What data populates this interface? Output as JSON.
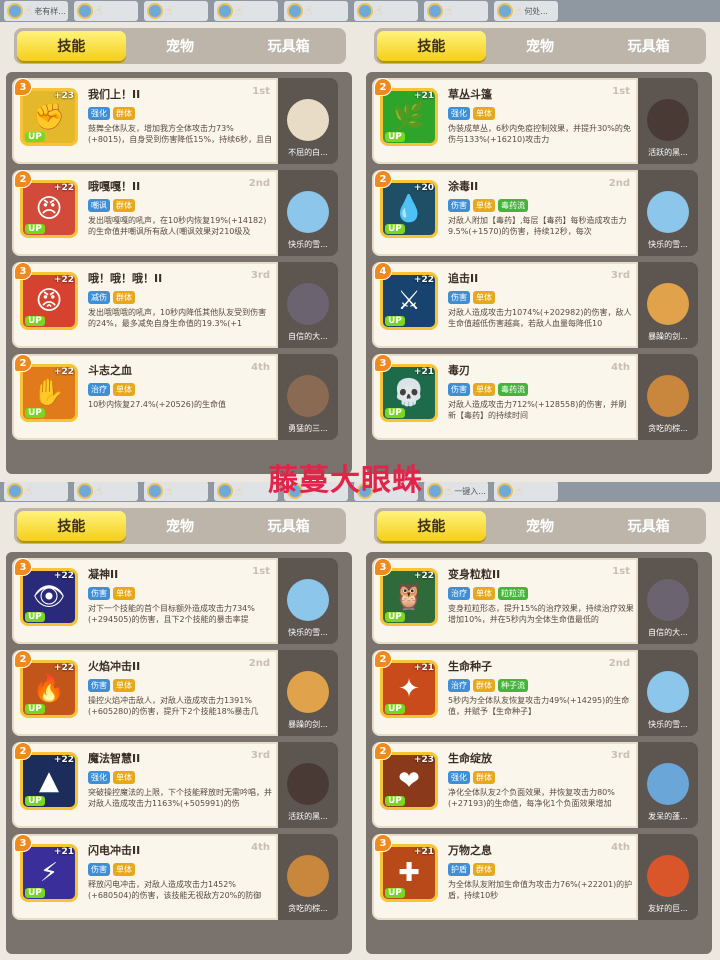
{
  "watermark": "藤蔓大眼蛛",
  "tabs": [
    "技能",
    "宠物",
    "玩具箱"
  ],
  "strip_top_texts": [
    "老有样...",
    "",
    "",
    "",
    "",
    "",
    "",
    "何处..."
  ],
  "strip_mid_texts": [
    "",
    "",
    "",
    "",
    "",
    "",
    "一键入...",
    ""
  ],
  "panels": [
    {
      "cards": [
        {
          "name": "我们上！II",
          "rank": "1st",
          "lvl": "3",
          "plus": "+23",
          "tags": [
            {
              "t": "强化",
              "c": "blue"
            },
            {
              "t": "群体",
              "c": "yellow"
            }
          ],
          "desc": "鼓舞全体队友，增加我方全体攻击力73%(+8015)，自身受到伤害降低15%，持续6秒，且自",
          "pet": "不屈的白...",
          "glyph": "✊",
          "bg": "#e3b82a",
          "petcolor": "#e8dcc6"
        },
        {
          "name": "哦嘎嘎！II",
          "rank": "2nd",
          "lvl": "2",
          "plus": "+22",
          "tags": [
            {
              "t": "嘲讽",
              "c": "blue"
            },
            {
              "t": "群体",
              "c": "yellow"
            }
          ],
          "desc": "发出哦嘎嘎的吼声，在10秒内恢复19%(+14182)的生命值并嘲讽所有敌人(嘲讽效果对210级及",
          "pet": "快乐的雪...",
          "glyph": "😠",
          "bg": "#d24a3a",
          "petcolor": "#8cc6ea"
        },
        {
          "name": "哦！哦！哦！II",
          "rank": "3rd",
          "lvl": "3",
          "plus": "+22",
          "tags": [
            {
              "t": "减伤",
              "c": "blue"
            },
            {
              "t": "群体",
              "c": "yellow"
            }
          ],
          "desc": "发出哦哦哦的吼声，10秒内降低其他队友受到伤害的24%，最多减免自身生命值的19.3%(+1",
          "pet": "自信的大...",
          "glyph": "😡",
          "bg": "#d5422f",
          "petcolor": "#6b6470"
        },
        {
          "name": "斗志之血",
          "rank": "4th",
          "lvl": "2",
          "plus": "+22",
          "tags": [
            {
              "t": "治疗",
              "c": "blue"
            },
            {
              "t": "单体",
              "c": "yellow"
            }
          ],
          "desc": "10秒内恢复27.4%(+20526)的生命值",
          "pet": "勇猛的三...",
          "glyph": "✋",
          "bg": "#e07a1a",
          "petcolor": "#8a6a52"
        }
      ]
    },
    {
      "cards": [
        {
          "name": "草丛斗篷",
          "rank": "1st",
          "lvl": "2",
          "plus": "+21",
          "tags": [
            {
              "t": "强化",
              "c": "blue"
            },
            {
              "t": "单体",
              "c": "yellow"
            }
          ],
          "desc": "伪装成草丛，6秒内免疫控制效果，并提升30%的免伤与133%(+16210)攻击力",
          "pet": "活跃的黑...",
          "glyph": "🌿",
          "bg": "#2ea52a",
          "petcolor": "#4a3a36"
        },
        {
          "name": "涂毒II",
          "rank": "2nd",
          "lvl": "2",
          "plus": "+20",
          "tags": [
            {
              "t": "伤害",
              "c": "blue"
            },
            {
              "t": "单体",
              "c": "yellow"
            },
            {
              "t": "毒药流",
              "c": "green"
            }
          ],
          "desc": "对敌人附加【毒药】,每层【毒药】每秒造成攻击力9.5%(+1570)的伤害，持续12秒，每次",
          "pet": "快乐的雪...",
          "glyph": "💧",
          "bg": "#1f4f66",
          "petcolor": "#8cc6ea"
        },
        {
          "name": "追击II",
          "rank": "3rd",
          "lvl": "4",
          "plus": "+22",
          "tags": [
            {
              "t": "伤害",
              "c": "blue"
            },
            {
              "t": "单体",
              "c": "yellow"
            }
          ],
          "desc": "对敌人造成攻击力1074%(+202982)的伤害，敌人生命值越低伤害越高，若敌人血量每降低10",
          "pet": "暴躁的剑...",
          "glyph": "⚔",
          "bg": "#17436e",
          "petcolor": "#e0a24a"
        },
        {
          "name": "毒刃",
          "rank": "4th",
          "lvl": "3",
          "plus": "+21",
          "tags": [
            {
              "t": "伤害",
              "c": "blue"
            },
            {
              "t": "单体",
              "c": "yellow"
            },
            {
              "t": "毒药流",
              "c": "green"
            }
          ],
          "desc": "对敌人造成攻击力712%(+128558)的伤害，并刷新【毒药】的持续时间",
          "pet": "贪吃的棕...",
          "glyph": "💀",
          "bg": "#1d6b4a",
          "petcolor": "#c8873c"
        }
      ]
    },
    {
      "cards": [
        {
          "name": "凝神II",
          "rank": "1st",
          "lvl": "3",
          "plus": "+22",
          "tags": [
            {
              "t": "伤害",
              "c": "blue"
            },
            {
              "t": "单体",
              "c": "yellow"
            }
          ],
          "desc": "对下一个技能的首个目标额外造成攻击力734%(+294505)的伤害，且下2个技能的暴击率提",
          "pet": "快乐的雪...",
          "glyph": "👁",
          "bg": "#2a2a7a",
          "petcolor": "#8cc6ea"
        },
        {
          "name": "火焰冲击II",
          "rank": "2nd",
          "lvl": "2",
          "plus": "+22",
          "tags": [
            {
              "t": "伤害",
              "c": "blue"
            },
            {
              "t": "单体",
              "c": "yellow"
            }
          ],
          "desc": "操控火焰冲击敌人，对敌人造成攻击力1391%(+605280)的伤害，提升下2个技能18%暴击几",
          "pet": "暴躁的剑...",
          "glyph": "🔥",
          "bg": "#c2561a",
          "petcolor": "#e0a24a"
        },
        {
          "name": "魔法智慧II",
          "rank": "3rd",
          "lvl": "2",
          "plus": "+22",
          "tags": [
            {
              "t": "强化",
              "c": "blue"
            },
            {
              "t": "单体",
              "c": "yellow"
            }
          ],
          "desc": "突破操控魔法的上限，下个技能释放时无需吟唱，并对敌人造成攻击力1163%(+505991)的伤",
          "pet": "活跃的黑...",
          "glyph": "▲",
          "bg": "#1c2d5c",
          "petcolor": "#4a3a36"
        },
        {
          "name": "闪电冲击II",
          "rank": "4th",
          "lvl": "3",
          "plus": "+21",
          "tags": [
            {
              "t": "伤害",
              "c": "blue"
            },
            {
              "t": "单体",
              "c": "yellow"
            }
          ],
          "desc": "释放闪电冲击，对敌人造成攻击力1452%(+680504)的伤害，该技能无视敌方20%的防御",
          "pet": "贪吃的棕...",
          "glyph": "⚡",
          "bg": "#3a2f9a",
          "petcolor": "#c8873c"
        }
      ]
    },
    {
      "cards": [
        {
          "name": "变身粒粒II",
          "rank": "1st",
          "lvl": "3",
          "plus": "+22",
          "tags": [
            {
              "t": "治疗",
              "c": "blue"
            },
            {
              "t": "单体",
              "c": "yellow"
            },
            {
              "t": "粒粒流",
              "c": "green"
            }
          ],
          "desc": "变身粒粒形态，提升15%的治疗效果，持续治疗效果增加10%，并在5秒内为全体生命值最低的",
          "pet": "自信的大...",
          "glyph": "🦉",
          "bg": "#2f6a3a",
          "petcolor": "#6b6470"
        },
        {
          "name": "生命种子",
          "rank": "2nd",
          "lvl": "2",
          "plus": "+21",
          "tags": [
            {
              "t": "治疗",
              "c": "blue"
            },
            {
              "t": "群体",
              "c": "yellow"
            },
            {
              "t": "种子流",
              "c": "green"
            }
          ],
          "desc": "5秒内为全体队友恢复攻击力49%(+14295)的生命值，并赋予【生命种子】",
          "pet": "快乐的雪...",
          "glyph": "✦",
          "bg": "#c94a1a",
          "petcolor": "#8cc6ea"
        },
        {
          "name": "生命绽放",
          "rank": "3rd",
          "lvl": "2",
          "plus": "+23",
          "tags": [
            {
              "t": "强化",
              "c": "blue"
            },
            {
              "t": "群体",
              "c": "yellow"
            }
          ],
          "desc": "净化全体队友2个负面效果，并恢复攻击力80%(+27193)的生命值，每净化1个负面效果增加",
          "pet": "发呆的蓬...",
          "glyph": "❤",
          "bg": "#8a3a1a",
          "petcolor": "#6aa6d8"
        },
        {
          "name": "万物之息",
          "rank": "4th",
          "lvl": "3",
          "plus": "+21",
          "tags": [
            {
              "t": "护盾",
              "c": "blue"
            },
            {
              "t": "群体",
              "c": "yellow"
            }
          ],
          "desc": "为全体队友附加生命值为攻击力76%(+22201)的护盾，持续10秒",
          "pet": "友好的巨...",
          "glyph": "✚",
          "bg": "#b84a1a",
          "petcolor": "#d8562a"
        }
      ]
    }
  ]
}
